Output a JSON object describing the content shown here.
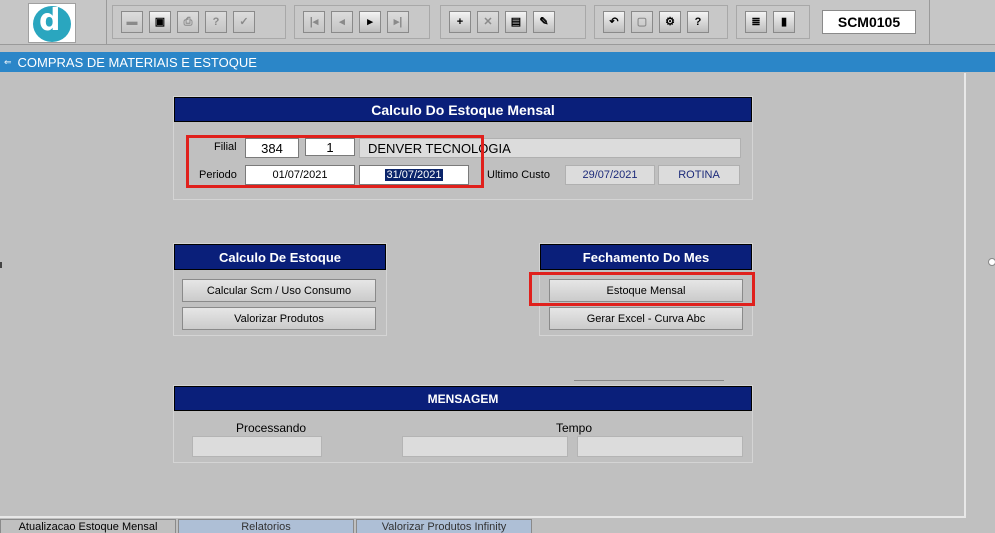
{
  "app": {
    "form_id": "SCM0105",
    "title": "COMPRAS DE MATERIAIS E ESTOQUE"
  },
  "toolbar": {
    "group1": [
      {
        "name": "save-icon",
        "glyph": "▬",
        "disabled": true
      },
      {
        "name": "screen-icon",
        "glyph": "▣",
        "disabled": false
      },
      {
        "name": "print-icon",
        "glyph": "⎙",
        "disabled": true
      },
      {
        "name": "query-icon",
        "glyph": "?",
        "disabled": true
      },
      {
        "name": "execute-query-icon",
        "glyph": "✓",
        "disabled": true
      }
    ],
    "group2": [
      {
        "name": "first-record-icon",
        "glyph": "|◂",
        "disabled": true
      },
      {
        "name": "prev-record-icon",
        "glyph": "◂",
        "disabled": true
      },
      {
        "name": "next-record-icon",
        "glyph": "▸",
        "disabled": false
      },
      {
        "name": "last-record-icon",
        "glyph": "▸|",
        "disabled": true
      }
    ],
    "group3": [
      {
        "name": "insert-record-icon",
        "glyph": "+",
        "disabled": false
      },
      {
        "name": "delete-record-icon",
        "glyph": "✕",
        "disabled": true
      },
      {
        "name": "list-values-icon",
        "glyph": "▤",
        "disabled": false
      },
      {
        "name": "edit-icon",
        "glyph": "✎",
        "disabled": false
      }
    ],
    "group4": [
      {
        "name": "undo-icon",
        "glyph": "↶",
        "disabled": false
      },
      {
        "name": "clear-icon",
        "glyph": "▢",
        "disabled": true
      },
      {
        "name": "options-icon",
        "glyph": "⚙",
        "disabled": false
      },
      {
        "name": "help-icon",
        "glyph": "?",
        "disabled": false
      }
    ],
    "group5": [
      {
        "name": "menu-icon",
        "glyph": "≣",
        "disabled": false
      },
      {
        "name": "exit-icon",
        "glyph": "▮",
        "disabled": false
      }
    ]
  },
  "calc_panel": {
    "header": "Calculo Do Estoque Mensal",
    "filial_label": "Filial",
    "filial_code": "384",
    "filial_num": "1",
    "filial_name": "DENVER TECNOLOGIA",
    "periodo_label": "Periodo",
    "periodo_start": "01/07/2021",
    "periodo_end": "31/07/2021",
    "ultimo_label": "Ultimo Custo",
    "ultimo_date": "29/07/2021",
    "ultimo_type": "ROTINA"
  },
  "estoque_panel": {
    "header": "Calculo De Estoque",
    "btn1": "Calcular Scm / Uso Consumo",
    "btn2": "Valorizar Produtos"
  },
  "fechamento_panel": {
    "header": "Fechamento Do Mes",
    "btn1": "Estoque Mensal",
    "btn2": "Gerar Excel - Curva Abc"
  },
  "mensagem_panel": {
    "header": "MENSAGEM",
    "processando_label": "Processando",
    "tempo_label": "Tempo"
  },
  "tabs": [
    {
      "label": "Atualizacao Estoque Mensal",
      "active": true
    },
    {
      "label": "Relatorios",
      "active": false
    },
    {
      "label": "Valorizar Produtos Infinity",
      "active": false
    }
  ]
}
